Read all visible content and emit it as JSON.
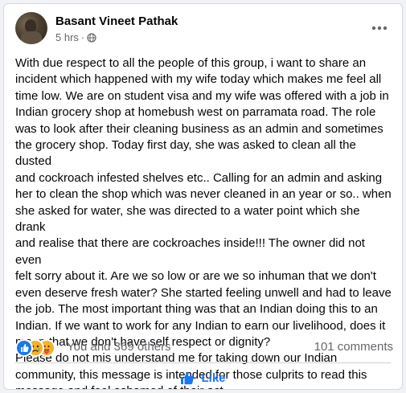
{
  "post": {
    "author": "Basant Vineet Pathak",
    "time": "5 hrs",
    "separator": "·",
    "privacy_icon": "globe-icon",
    "more_icon": "more-horizontal-icon",
    "text": "With due respect to all the people of this group, i want to share an\nincident which happened with my wife today which makes me feel all\ntime low. We are on student visa and my wife was offered with a job in\nIndian grocery shop at homebush west on parramata road. The role\nwas to look after their cleaning business as an admin and sometimes\nthe grocery shop. Today first day, she was asked to clean all the dusted\nand cockroach infested shelves etc.. Calling for an admin and asking\nher to clean the shop which was never cleaned in an year or so.. when\nshe asked for water, she was directed to a water point which she drank\nand realise that there are cockroaches inside!!! The owner did not even\nfelt sorry about it. Are we so low or are we so inhuman that we don't\neven deserve fresh water? She started feeling unwell and had to leave\nthe job. The most important thing was that an Indian doing this to an\nIndian. If we want to work for any Indian to earn our livelihood, does it\nmean that we don't have self respect or dignity?\nPlease do not mis understand me for taking down our Indian\ncommunity, this message is intended for those culprits to read this\nmessage and feel ashamed of their act."
  },
  "reactions": {
    "icons": [
      "like-reaction-icon",
      "sad-reaction-icon",
      "care-reaction-icon"
    ],
    "summary": "You and 369 others",
    "comments": "101 comments"
  },
  "actions": {
    "like_label": "Like",
    "like_icon": "thumbs-up-icon"
  },
  "colors": {
    "accent": "#1877f2",
    "secondary_text": "#65676b",
    "primary_text": "#050505",
    "background": "#f0f2f5"
  }
}
